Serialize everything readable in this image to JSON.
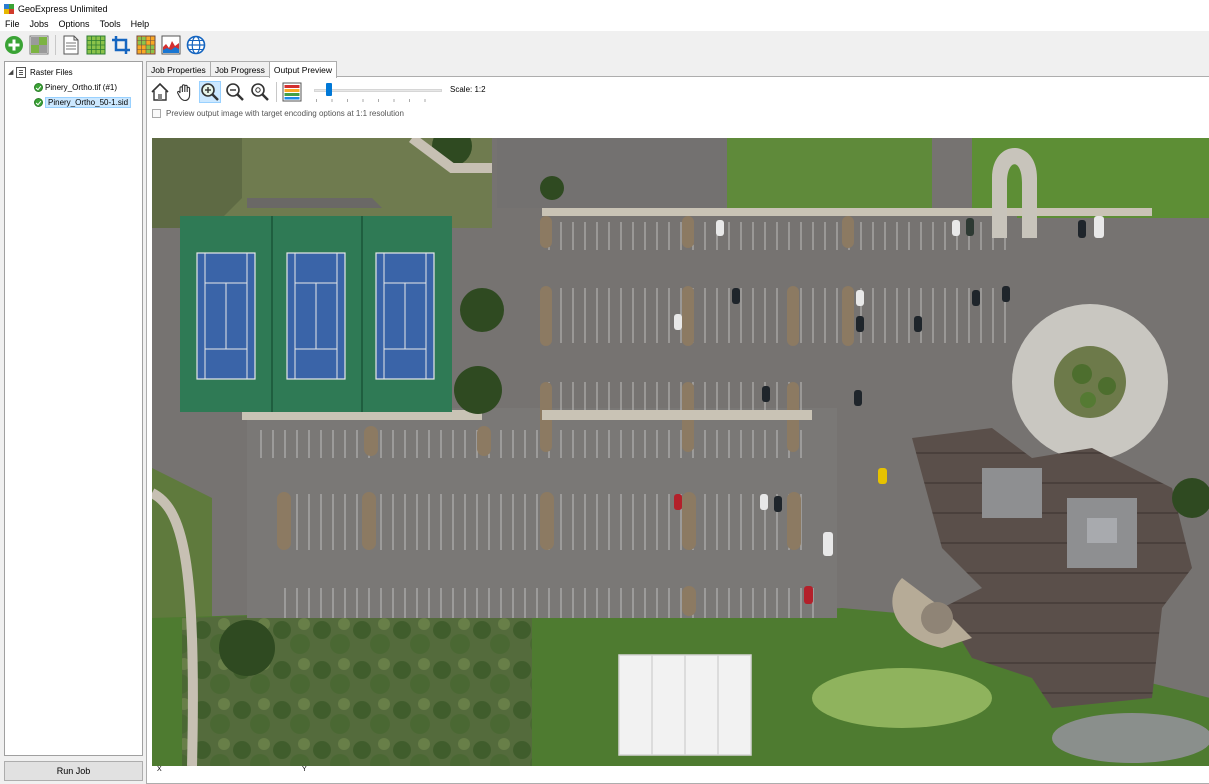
{
  "window": {
    "title": "GeoExpress Unlimited"
  },
  "menu": [
    "File",
    "Jobs",
    "Options",
    "Tools",
    "Help"
  ],
  "toolbar": {
    "buttons": [
      "add-icon",
      "mosaic-icon",
      "document-icon",
      "grid-icon",
      "crop-icon",
      "color-grid-icon",
      "histogram-icon",
      "globe-icon"
    ]
  },
  "tree": {
    "root_label": "Raster Files",
    "items": [
      {
        "label": "Pinery_Ortho.tif (#1)",
        "status": "ok"
      },
      {
        "label": "Pinery_Ortho_50-1.sid",
        "status": "ok",
        "selected": true
      }
    ]
  },
  "run_job_label": "Run Job",
  "tabs": [
    {
      "label": "Job Properties",
      "active": false
    },
    {
      "label": "Job Progress",
      "active": false
    },
    {
      "label": "Output Preview",
      "active": true
    }
  ],
  "preview": {
    "tools": [
      "home-icon",
      "pan-hand-icon",
      "zoom-in-icon",
      "zoom-out-icon",
      "zoom-fit-icon",
      "bands-icon"
    ],
    "active_tool": "zoom-in-icon",
    "scale_label": "Scale: 1:2",
    "slider_fraction": 0.1,
    "checkbox_label": "Preview output image with target encoding options at 1:1 resolution",
    "checkbox_checked": false,
    "axis_x": "X",
    "axis_y": "Y"
  },
  "colors": {
    "accent": "#0078d7",
    "selection": "#cce8ff",
    "status_ok": "#3aa335"
  }
}
